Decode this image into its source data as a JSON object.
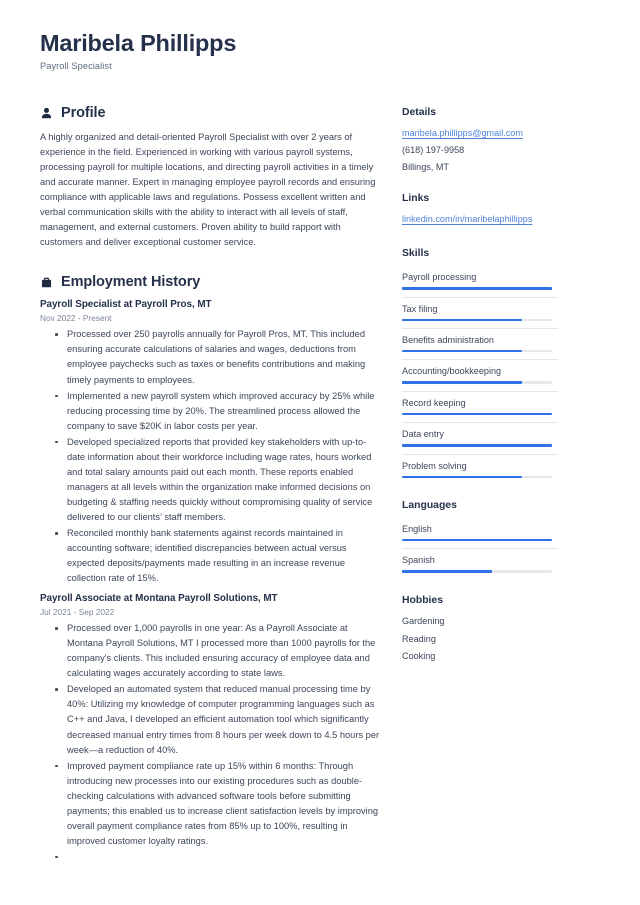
{
  "header": {
    "name": "Maribela Phillipps",
    "job_title": "Payroll Specialist"
  },
  "main": {
    "profile": {
      "heading": "Profile",
      "icon": "person-icon",
      "text": "A highly organized and detail-oriented Payroll Specialist with over 2 years of experience in the field. Experienced in working with various payroll systems, processing payroll for multiple locations, and directing payroll activities in a timely and accurate manner. Expert in managing employee payroll records and ensuring compliance with applicable laws and regulations. Possess excellent written and verbal communication skills with the ability to interact with all levels of staff, management, and external customers. Proven ability to build rapport with customers and deliver exceptional customer service."
    },
    "employment": {
      "heading": "Employment History",
      "icon": "briefcase-icon",
      "jobs": [
        {
          "title": "Payroll Specialist at Payroll Pros, MT",
          "dates": "Nov 2022 - Present",
          "bullets": [
            "Processed over 250 payrolls annually for Payroll Pros, MT. This included ensuring accurate calculations of salaries and wages, deductions from employee paychecks such as taxes or benefits contributions and making timely payments to employees.",
            "Implemented a new payroll system which improved accuracy by 25% while reducing processing time by 20%. The streamlined process allowed the company to save $20K in labor costs per year.",
            "Developed specialized reports that provided key stakeholders with up-to-date information about their workforce including wage rates, hours worked and total salary amounts paid out each month. These reports enabled managers at all levels within the organization make informed decisions on budgeting & staffing needs quickly without compromising quality of service delivered to our clients’ staff members.",
            "Reconciled monthly bank statements against records maintained in accounting software; identified discrepancies between actual versus expected deposits/payments made resulting in an increase revenue collection rate of 15%."
          ]
        },
        {
          "title": "Payroll Associate at Montana Payroll Solutions, MT",
          "dates": "Jul 2021 - Sep 2022",
          "bullets": [
            "Processed over 1,000 payrolls in one year: As a Payroll Associate at Montana Payroll Solutions, MT I processed more than 1000 payrolls for the company's clients. This included ensuring accuracy of employee data and calculating wages accurately according to state laws.",
            "Developed an automated system that reduced manual processing time by 40%: Utilizing my knowledge of computer programming languages such as C++ and Java, I developed an efficient automation tool which significantly decreased manual entry times from 8 hours per week down to 4.5 hours per week—a reduction of 40%.",
            "Improved payment compliance rate up 15% within 6 months: Through introducing new processes into our existing procedures such as double-checking calculations with advanced software tools before submitting payments; this enabled us to increase client satisfaction levels by improving overall payment compliance rates from 85% up to 100%, resulting in improved customer loyalty ratings.",
            ""
          ]
        }
      ]
    }
  },
  "sidebar": {
    "details": {
      "heading": "Details",
      "email": "maribela.phillipps@gmail.com",
      "phone": "(618) 197-9958",
      "location": "Billings, MT"
    },
    "links": {
      "heading": "Links",
      "items": [
        "linkedin.com/in/maribelaphillipps"
      ]
    },
    "skills": {
      "heading": "Skills",
      "items": [
        {
          "label": "Payroll processing",
          "level": 100
        },
        {
          "label": "Tax filing",
          "level": 80
        },
        {
          "label": "Benefits administration",
          "level": 80
        },
        {
          "label": "Accounting/bookkeeping",
          "level": 80
        },
        {
          "label": "Record keeping",
          "level": 100
        },
        {
          "label": "Data entry",
          "level": 100
        },
        {
          "label": "Problem solving",
          "level": 80
        }
      ]
    },
    "languages": {
      "heading": "Languages",
      "items": [
        {
          "label": "English",
          "level": 100
        },
        {
          "label": "Spanish",
          "level": 60
        }
      ]
    },
    "hobbies": {
      "heading": "Hobbies",
      "items": [
        "Gardening",
        "Reading",
        "Cooking"
      ]
    }
  },
  "colors": {
    "accent": "#2f72e8",
    "link": "#4f82d8",
    "heading": "#25304a",
    "body_text": "#3c4759",
    "muted": "#7b8699",
    "track": "#e6e8eb",
    "divider": "#e3e6ea"
  }
}
